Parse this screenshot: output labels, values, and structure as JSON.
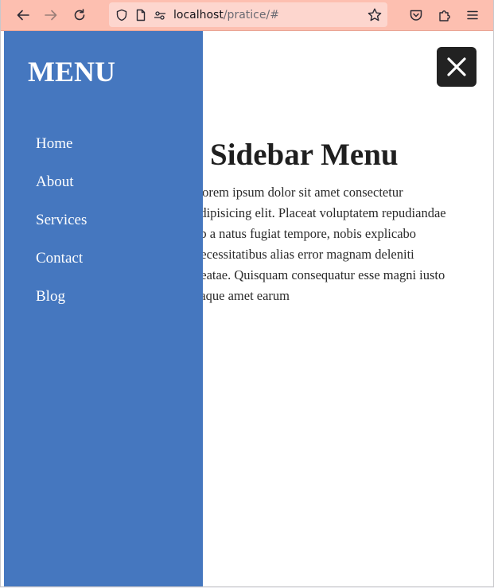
{
  "browser": {
    "url_host": "localhost",
    "url_path": "/pratice/#",
    "icons": [
      "back-icon",
      "forward-icon",
      "reload-icon",
      "shield-icon",
      "page-icon",
      "site-permissions-icon",
      "bookmark-star-icon",
      "pocket-icon",
      "extensions-icon",
      "menu-icon"
    ]
  },
  "sidebar": {
    "title": "MENU",
    "items": [
      {
        "label": "Home"
      },
      {
        "label": "About"
      },
      {
        "label": "Services"
      },
      {
        "label": "Contact"
      },
      {
        "label": "Blog"
      }
    ]
  },
  "main": {
    "title": "Sidebar Menu",
    "paragraph": "Lorem ipsum dolor sit amet consectetur adipisicing elit. Placeat voluptatem repudiandae ab a natus fugiat tempore, nobis explicabo necessitatibus alias error magnam deleniti beatae. Quisquam consequatur esse magni iusto eaque amet earum",
    "close_icon": "close-icon"
  },
  "colors": {
    "toolbar": "#fdbfb0",
    "urlbar": "#fdd6ce",
    "sidebar": "#4577bf",
    "close_button": "#222222"
  }
}
